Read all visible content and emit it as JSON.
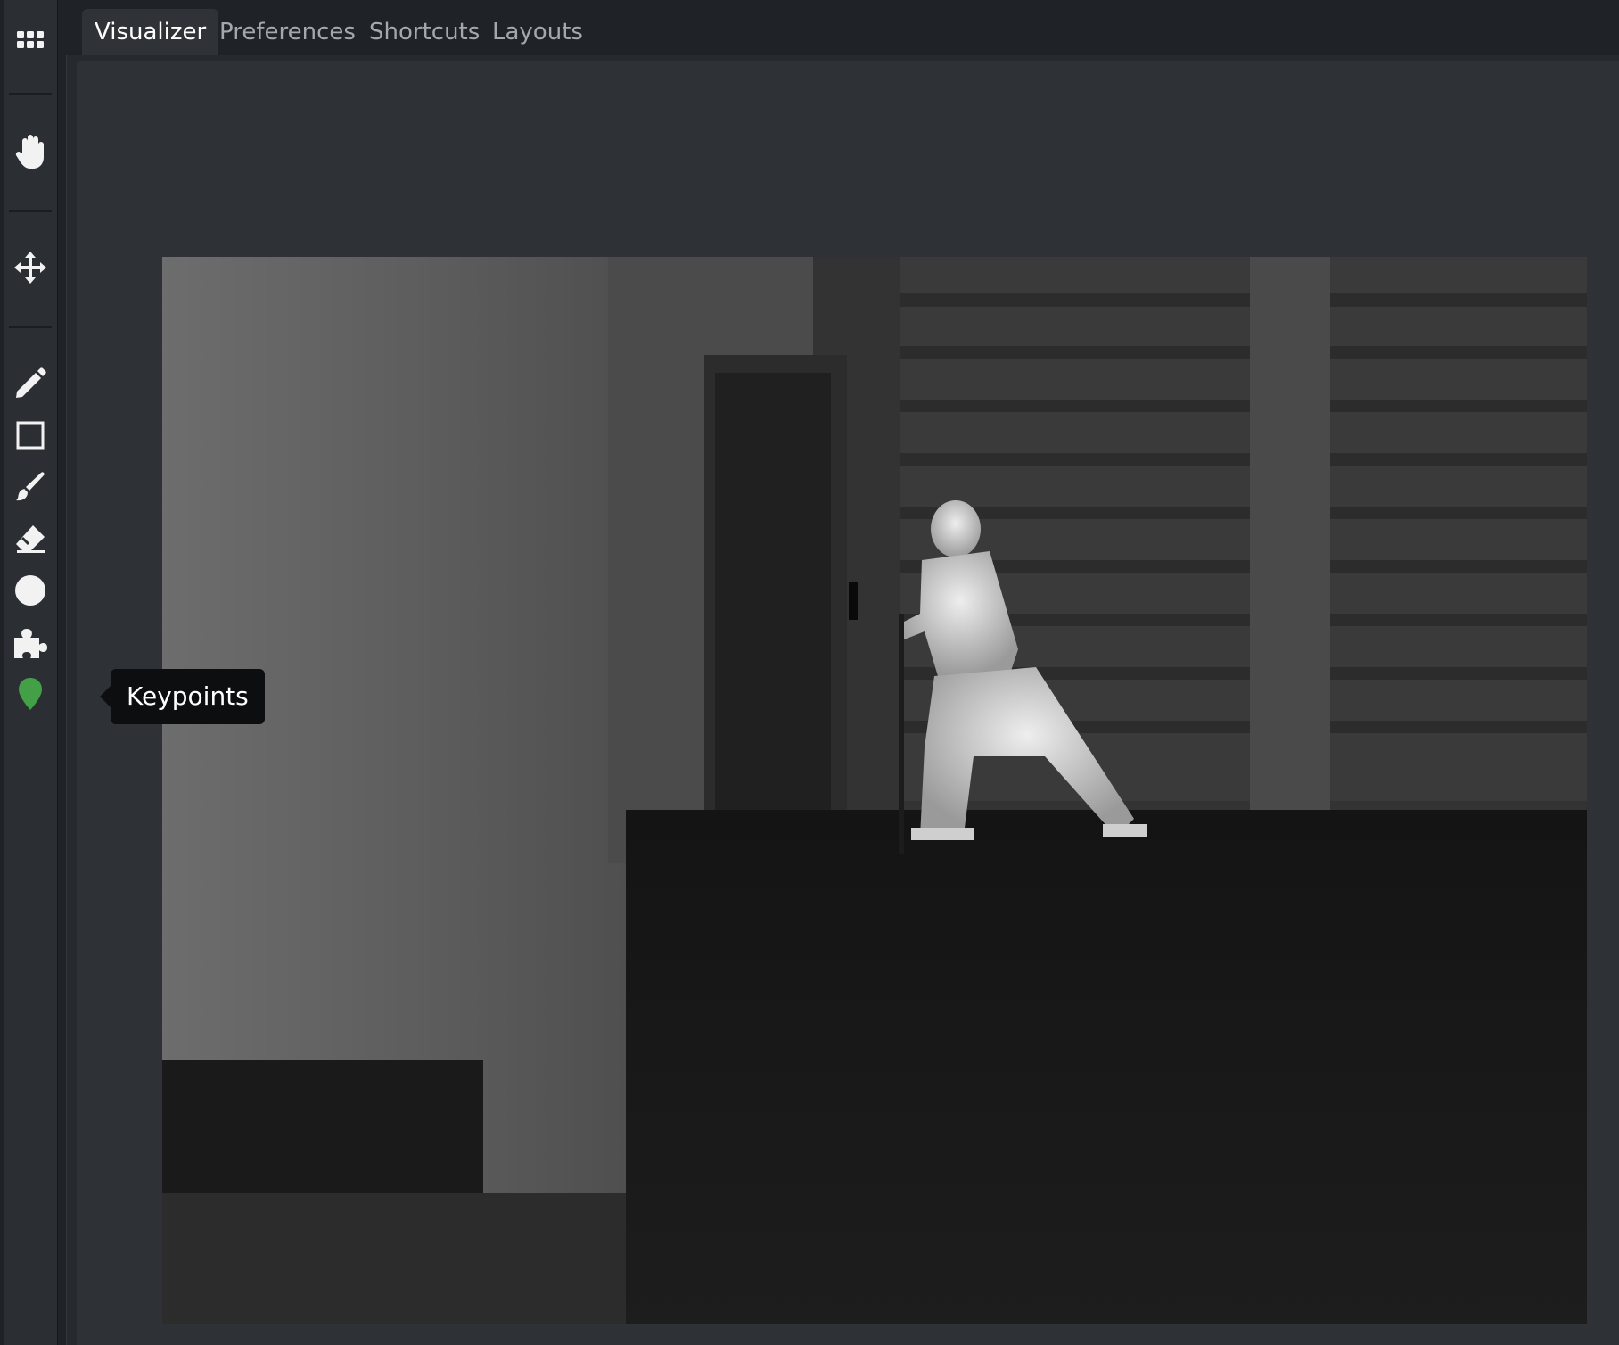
{
  "tabs": [
    {
      "label": "Visualizer",
      "active": true
    },
    {
      "label": "Preferences",
      "active": false
    },
    {
      "label": "Shortcuts",
      "active": false
    },
    {
      "label": "Layouts",
      "active": false
    }
  ],
  "toolbar": {
    "tools": [
      {
        "icon": "grid-menu-icon",
        "tooltip": ""
      },
      {
        "icon": "hand-pan-icon",
        "tooltip": ""
      },
      {
        "icon": "move-arrows-icon",
        "tooltip": ""
      },
      {
        "icon": "pencil-icon",
        "tooltip": ""
      },
      {
        "icon": "rectangle-icon",
        "tooltip": ""
      },
      {
        "icon": "brush-icon",
        "tooltip": ""
      },
      {
        "icon": "eraser-icon",
        "tooltip": ""
      },
      {
        "icon": "circle-icon",
        "tooltip": ""
      },
      {
        "icon": "puzzle-icon",
        "tooltip": ""
      },
      {
        "icon": "map-pin-icon",
        "tooltip": "Keypoints",
        "color": "#43a047"
      }
    ]
  },
  "tooltip": {
    "text": "Keypoints"
  },
  "canvas": {
    "image_description": "thermal grayscale image of a person at a door"
  },
  "colors": {
    "accent_pin": "#43a047",
    "background": "#1f2226",
    "panel": "#2e3237"
  }
}
